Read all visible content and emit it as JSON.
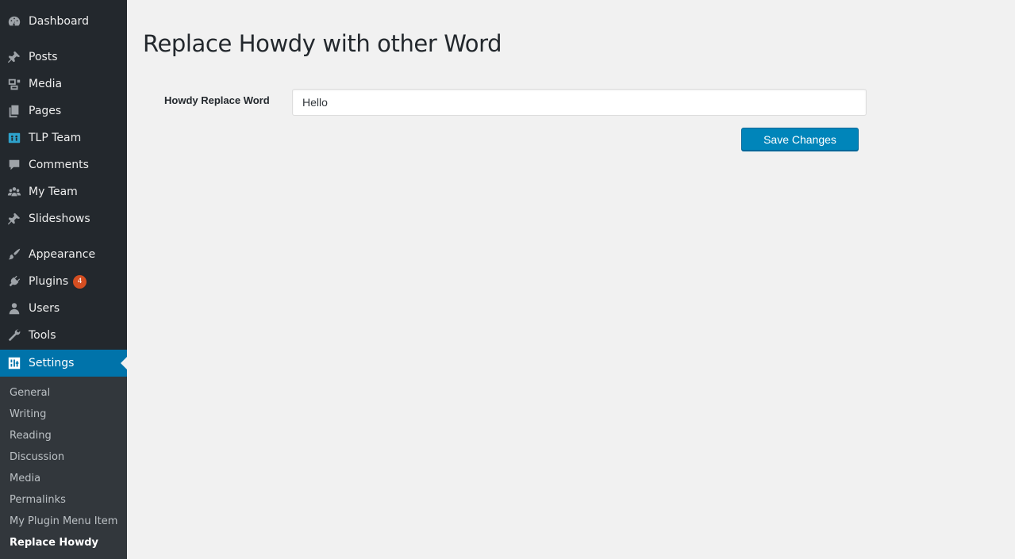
{
  "sidebar": {
    "items": [
      {
        "label": "Dashboard",
        "icon": "dashboard-icon"
      },
      {
        "label": "Posts",
        "icon": "pin-icon"
      },
      {
        "label": "Media",
        "icon": "media-icon"
      },
      {
        "label": "Pages",
        "icon": "pages-icon"
      },
      {
        "label": "TLP Team",
        "icon": "team-logo-icon"
      },
      {
        "label": "Comments",
        "icon": "comment-icon"
      },
      {
        "label": "My Team",
        "icon": "groups-icon"
      },
      {
        "label": "Slideshows",
        "icon": "pin-icon"
      },
      {
        "label": "Appearance",
        "icon": "brush-icon"
      },
      {
        "label": "Plugins",
        "icon": "plug-icon",
        "badge": "4"
      },
      {
        "label": "Users",
        "icon": "user-icon"
      },
      {
        "label": "Tools",
        "icon": "wrench-icon"
      },
      {
        "label": "Settings",
        "icon": "settings-icon"
      }
    ],
    "submenu": [
      "General",
      "Writing",
      "Reading",
      "Discussion",
      "Media",
      "Permalinks",
      "My Plugin Menu Item",
      "Replace Howdy"
    ]
  },
  "main": {
    "title": "Replace Howdy with other Word",
    "field_label": "Howdy Replace Word",
    "field_value": "Hello",
    "save_label": "Save Changes"
  },
  "colors": {
    "sidebar_bg": "#23282d",
    "submenu_bg": "#32373c",
    "accent": "#0073aa",
    "button": "#0085ba",
    "badge": "#d54e21",
    "page_bg": "#f1f1f1"
  }
}
